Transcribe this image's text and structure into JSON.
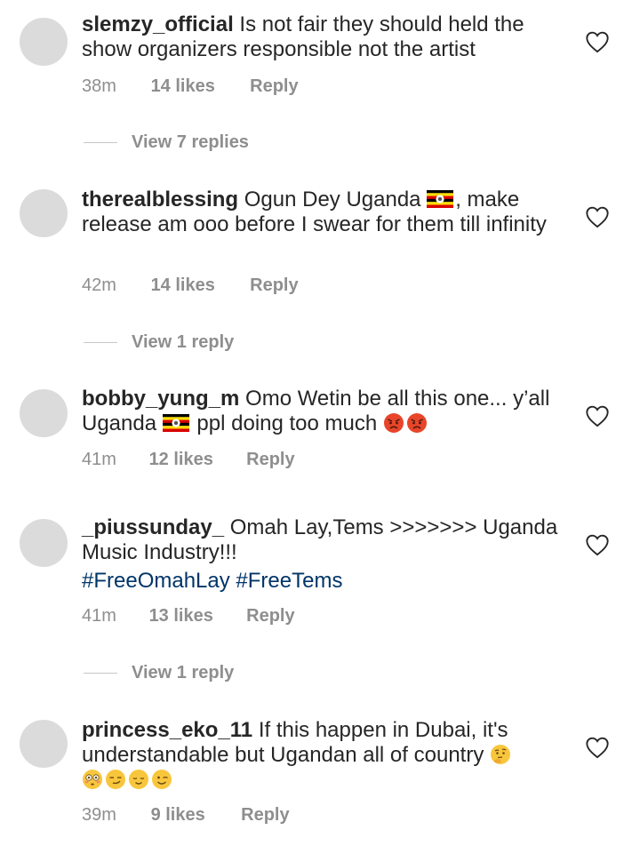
{
  "comments": [
    {
      "username": "slemzy_official",
      "text": "Is not fair they should held the show organizers responsible not the artist",
      "time": "38m",
      "likes": "14 likes",
      "reply": "Reply",
      "view_replies": "View 7 replies"
    },
    {
      "username": "therealblessing",
      "text_before_flag": "Ogun Dey Uganda",
      "text_after_flag": ", make release am ooo before I swear for them till infinity",
      "time": "42m",
      "likes": "14 likes",
      "reply": "Reply",
      "view_replies": "View 1 reply"
    },
    {
      "username": "bobby_yung_m",
      "text_before_flag": "Omo Wetin be all this one... y’all Uganda",
      "text_after_flag": "ppl doing too much",
      "time": "41m",
      "likes": "12 likes",
      "reply": "Reply"
    },
    {
      "username": "_piussunday_",
      "text": "Omah Lay,Tems >>>>>>> Uganda Music Industry!!!",
      "hashtags": "#FreeOmahLay #FreeTems",
      "time": "41m",
      "likes": "13 likes",
      "reply": "Reply",
      "view_replies": "View 1 reply"
    },
    {
      "username": "princess_eko_11",
      "text": "If this happen in Dubai, it's understandable but Ugandan all of country",
      "time": "39m",
      "likes": "9 likes",
      "reply": "Reply"
    }
  ],
  "icons": {
    "heart": "heart-outline-icon",
    "flag": "uganda-flag-icon",
    "angry": "angry-face-emoji",
    "thinking": "thinking-face-emoji",
    "flushed": "flushed-face-emoji",
    "smirk": "smirking-face-emoji",
    "relieved": "relieved-face-emoji",
    "wink": "winking-face-emoji"
  },
  "colors": {
    "avatar": "#dbdbdb",
    "meta_text": "#8e8e8e",
    "hashtag": "#003569",
    "primary_text": "#262626"
  }
}
